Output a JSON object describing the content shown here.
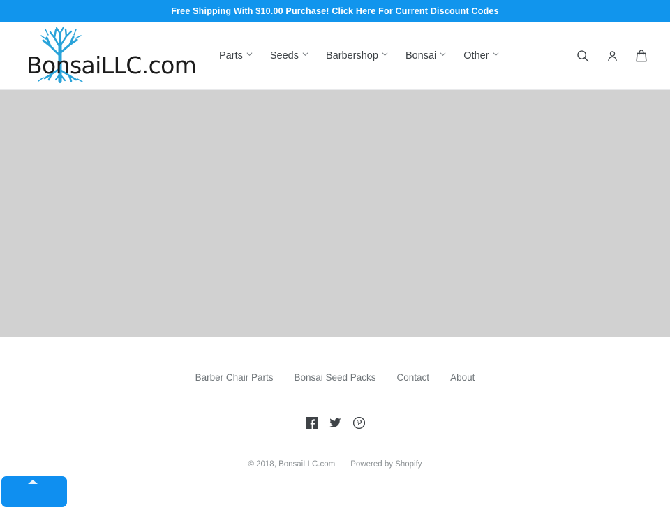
{
  "announcement": {
    "text": "Free Shipping With $10.00 Purchase! Click Here For Current Discount Codes",
    "background_color": "#1195ed",
    "text_color": "#ffffff"
  },
  "header": {
    "logo_text": "BonsaiLLC.com",
    "logo_icon": "bonsai-tree-icon",
    "logo_accent_color": "#1f9fd4",
    "nav_items": [
      {
        "label": "Parts",
        "has_dropdown": true
      },
      {
        "label": "Seeds",
        "has_dropdown": true
      },
      {
        "label": "Barbershop",
        "has_dropdown": true
      },
      {
        "label": "Bonsai",
        "has_dropdown": true
      },
      {
        "label": "Other",
        "has_dropdown": true
      }
    ],
    "icons": [
      {
        "name": "search-icon",
        "label": "Search"
      },
      {
        "name": "account-icon",
        "label": "Log in"
      },
      {
        "name": "cart-icon",
        "label": "Cart"
      }
    ]
  },
  "main": {
    "placeholder_color": "#d1d1d1"
  },
  "footer": {
    "links": [
      {
        "label": "Barber Chair Parts"
      },
      {
        "label": "Bonsai Seed Packs"
      },
      {
        "label": "Contact"
      },
      {
        "label": "About"
      }
    ],
    "social": [
      {
        "name": "facebook-icon",
        "label": "Facebook"
      },
      {
        "name": "twitter-icon",
        "label": "Twitter"
      },
      {
        "name": "pinterest-icon",
        "label": "Pinterest"
      }
    ],
    "copyright": "© 2018, BonsaiLLC.com",
    "powered_by": "Powered by Shopify"
  },
  "chat_widget": {
    "color": "#0f8ff0"
  }
}
